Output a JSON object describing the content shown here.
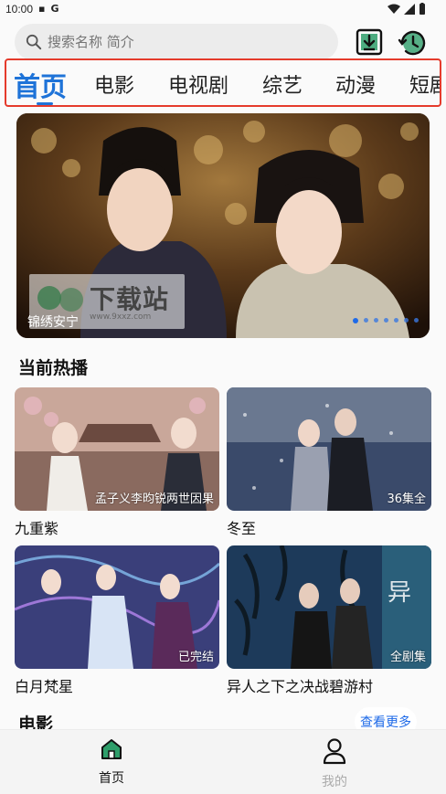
{
  "status": {
    "time": "10:00",
    "notif_icon": "G"
  },
  "search": {
    "placeholder": "搜索名称 简介"
  },
  "tabs": [
    {
      "label": "首页",
      "active": true
    },
    {
      "label": "电影"
    },
    {
      "label": "电视剧"
    },
    {
      "label": "综艺"
    },
    {
      "label": "动漫"
    },
    {
      "label": "短剧"
    }
  ],
  "banner": {
    "title": "锦绣安宁",
    "watermark_text": "下载站",
    "watermark_url": "www.9xxz.com",
    "slide_count": 7,
    "active_slide": 0
  },
  "sections": {
    "hot_title": "当前热播",
    "movie_title": "电影",
    "more_label": "查看更多"
  },
  "hot": [
    {
      "title": "九重紫",
      "badge": "孟子义李昀锐两世因果"
    },
    {
      "title": "冬至",
      "badge": "36集全"
    },
    {
      "title": "白月梵星",
      "badge": "已完结"
    },
    {
      "title": "异人之下之决战碧游村",
      "badge": "全剧集"
    }
  ],
  "nav": {
    "home_label": "首页",
    "mine_label": "我的"
  },
  "colors": {
    "accent": "#1e73d8",
    "highlight_border": "#e53b2c",
    "home_icon": "#2e9e6a"
  }
}
